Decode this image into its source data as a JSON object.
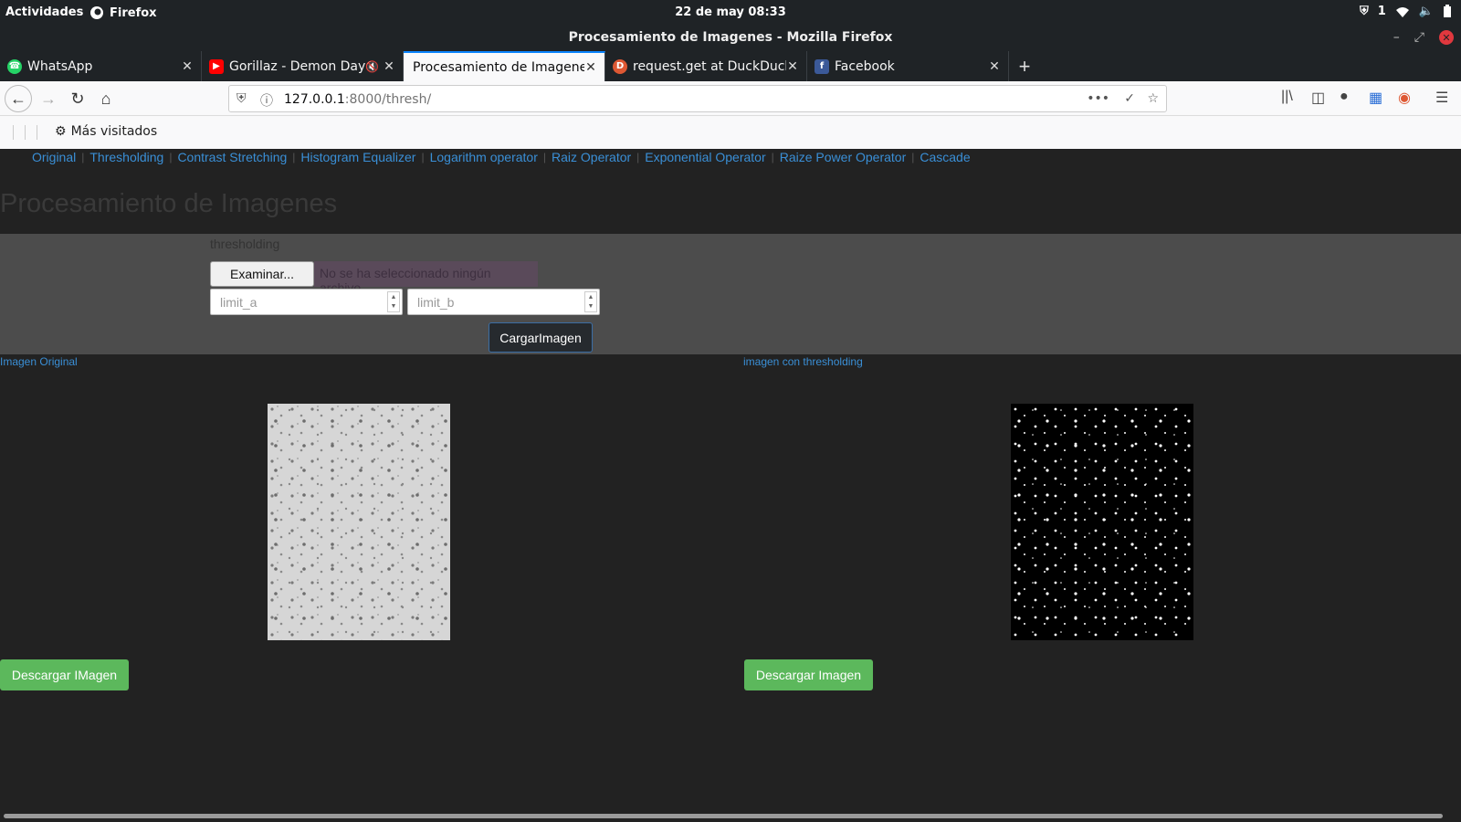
{
  "system_bar": {
    "activities": "Actividades",
    "app_name": "Firefox",
    "clock": "22 de may  08:33",
    "notification_count": "1"
  },
  "window": {
    "title": "Procesamiento de Imagenes - Mozilla Firefox"
  },
  "tabs": [
    {
      "label": "WhatsApp",
      "icon": "whatsapp-icon",
      "active": false
    },
    {
      "label": "Gorillaz - Demon Days",
      "icon": "youtube-icon",
      "active": false
    },
    {
      "label": "Procesamiento de Imagenes",
      "icon": "",
      "active": true
    },
    {
      "label": "request.get at DuckDuckGo",
      "icon": "duckduckgo-icon",
      "active": false
    },
    {
      "label": "Facebook",
      "icon": "facebook-icon",
      "active": false
    }
  ],
  "navigation": {
    "url_host": "127.0.0.1",
    "url_rest": ":8000/thresh/"
  },
  "bookmarks": {
    "most_visited": "Más visitados"
  },
  "page": {
    "nav_links": [
      "Original",
      "Thresholding",
      "Contrast Stretching",
      "Histogram Equalizer",
      "Logarithm operator",
      "Raiz Operator",
      "Exponential Operator",
      "Raize Power Operator",
      "Cascade"
    ],
    "heading": "Procesamiento de Imagenes",
    "form": {
      "label": "thresholding",
      "file_button": "Examinar...",
      "file_status": "No se ha seleccionado ningún archivo.",
      "limit_a_placeholder": "limit_a",
      "limit_b_placeholder": "limit_b",
      "submit": "CargarImagen"
    },
    "original": {
      "title": "Imagen Original",
      "download": "Descargar IMagen"
    },
    "processed": {
      "title": "imagen con thresholding",
      "download": "Descargar Imagen"
    }
  },
  "colors": {
    "link": "#3a8fd6",
    "download_button": "#5cb85c",
    "page_background": "#222222",
    "form_panel": "#4c4c4c"
  }
}
